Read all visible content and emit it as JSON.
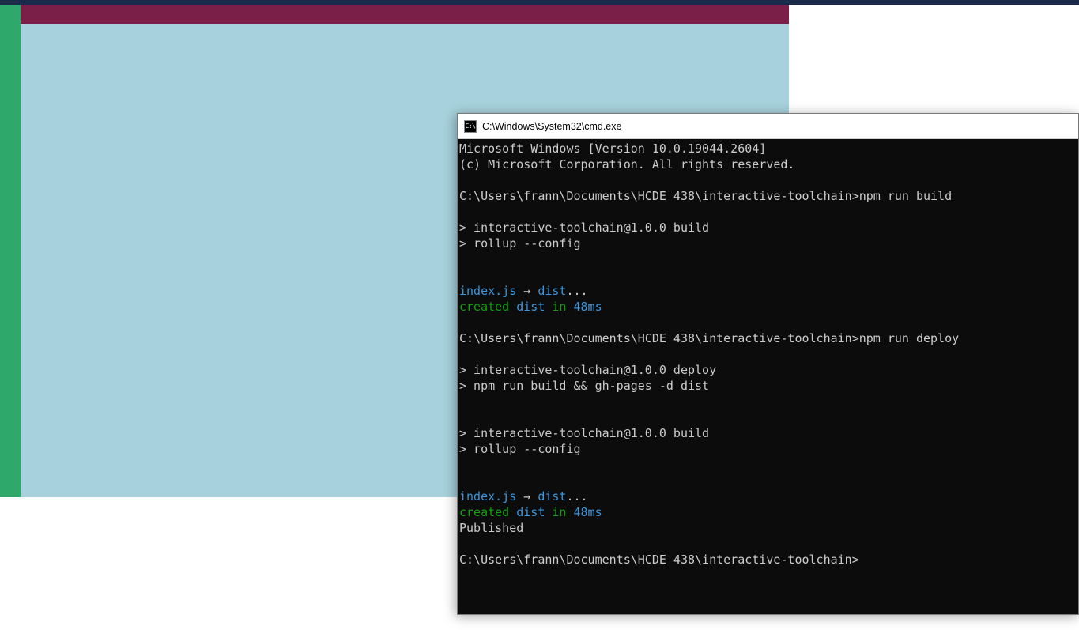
{
  "cmd": {
    "icon_label": "C:\\",
    "title": "C:\\Windows\\System32\\cmd.exe",
    "lines": [
      {
        "segments": [
          {
            "cls": "white",
            "text": "Microsoft Windows [Version 10.0.19044.2604]"
          }
        ]
      },
      {
        "segments": [
          {
            "cls": "white",
            "text": "(c) Microsoft Corporation. All rights reserved."
          }
        ]
      },
      {
        "segments": [
          {
            "cls": "white",
            "text": ""
          }
        ]
      },
      {
        "segments": [
          {
            "cls": "white",
            "text": "C:\\Users\\frann\\Documents\\HCDE 438\\interactive-toolchain>npm run build"
          }
        ]
      },
      {
        "segments": [
          {
            "cls": "white",
            "text": ""
          }
        ]
      },
      {
        "segments": [
          {
            "cls": "white",
            "text": "> interactive-toolchain@1.0.0 build"
          }
        ]
      },
      {
        "segments": [
          {
            "cls": "white",
            "text": "> rollup --config"
          }
        ]
      },
      {
        "segments": [
          {
            "cls": "white",
            "text": ""
          }
        ]
      },
      {
        "segments": [
          {
            "cls": "white",
            "text": ""
          }
        ]
      },
      {
        "segments": [
          {
            "cls": "cyan",
            "text": "index.js"
          },
          {
            "cls": "white",
            "text": " → "
          },
          {
            "cls": "cyan",
            "text": "dist"
          },
          {
            "cls": "white",
            "text": "..."
          }
        ]
      },
      {
        "segments": [
          {
            "cls": "green",
            "text": "created "
          },
          {
            "cls": "cyan",
            "text": "dist"
          },
          {
            "cls": "green",
            "text": " in "
          },
          {
            "cls": "cyan",
            "text": "48ms"
          }
        ]
      },
      {
        "segments": [
          {
            "cls": "white",
            "text": ""
          }
        ]
      },
      {
        "segments": [
          {
            "cls": "white",
            "text": "C:\\Users\\frann\\Documents\\HCDE 438\\interactive-toolchain>npm run deploy"
          }
        ]
      },
      {
        "segments": [
          {
            "cls": "white",
            "text": ""
          }
        ]
      },
      {
        "segments": [
          {
            "cls": "white",
            "text": "> interactive-toolchain@1.0.0 deploy"
          }
        ]
      },
      {
        "segments": [
          {
            "cls": "white",
            "text": "> npm run build && gh-pages -d dist"
          }
        ]
      },
      {
        "segments": [
          {
            "cls": "white",
            "text": ""
          }
        ]
      },
      {
        "segments": [
          {
            "cls": "white",
            "text": ""
          }
        ]
      },
      {
        "segments": [
          {
            "cls": "white",
            "text": "> interactive-toolchain@1.0.0 build"
          }
        ]
      },
      {
        "segments": [
          {
            "cls": "white",
            "text": "> rollup --config"
          }
        ]
      },
      {
        "segments": [
          {
            "cls": "white",
            "text": ""
          }
        ]
      },
      {
        "segments": [
          {
            "cls": "white",
            "text": ""
          }
        ]
      },
      {
        "segments": [
          {
            "cls": "cyan",
            "text": "index.js"
          },
          {
            "cls": "white",
            "text": " → "
          },
          {
            "cls": "cyan",
            "text": "dist"
          },
          {
            "cls": "white",
            "text": "..."
          }
        ]
      },
      {
        "segments": [
          {
            "cls": "green",
            "text": "created "
          },
          {
            "cls": "cyan",
            "text": "dist"
          },
          {
            "cls": "green",
            "text": " in "
          },
          {
            "cls": "cyan",
            "text": "48ms"
          }
        ]
      },
      {
        "segments": [
          {
            "cls": "white",
            "text": "Published"
          }
        ]
      },
      {
        "segments": [
          {
            "cls": "white",
            "text": ""
          }
        ]
      },
      {
        "segments": [
          {
            "cls": "white",
            "text": "C:\\Users\\frann\\Documents\\HCDE 438\\interactive-toolchain>"
          }
        ]
      }
    ]
  }
}
